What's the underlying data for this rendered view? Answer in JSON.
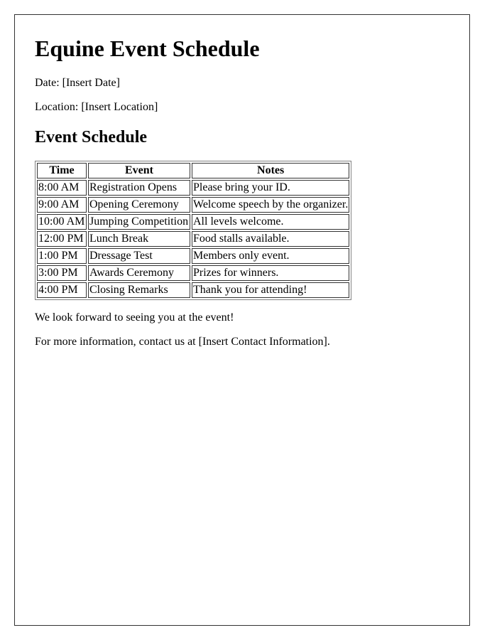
{
  "document": {
    "title": "Equine Event Schedule",
    "date_line": "Date: [Insert Date]",
    "location_line": "Location: [Insert Location]",
    "section_heading": "Event Schedule"
  },
  "schedule": {
    "headers": [
      "Time",
      "Event",
      "Notes"
    ],
    "rows": [
      {
        "time": "8:00 AM",
        "event": "Registration Opens",
        "notes": "Please bring your ID."
      },
      {
        "time": "9:00 AM",
        "event": "Opening Ceremony",
        "notes": "Welcome speech by the organizer."
      },
      {
        "time": "10:00 AM",
        "event": "Jumping Competition",
        "notes": "All levels welcome."
      },
      {
        "time": "12:00 PM",
        "event": "Lunch Break",
        "notes": "Food stalls available."
      },
      {
        "time": "1:00 PM",
        "event": "Dressage Test",
        "notes": "Members only event."
      },
      {
        "time": "3:00 PM",
        "event": "Awards Ceremony",
        "notes": "Prizes for winners."
      },
      {
        "time": "4:00 PM",
        "event": "Closing Remarks",
        "notes": "Thank you for attending!"
      }
    ]
  },
  "footer": {
    "closing_line": "We look forward to seeing you at the event!",
    "contact_line": "For more information, contact us at [Insert Contact Information]."
  }
}
